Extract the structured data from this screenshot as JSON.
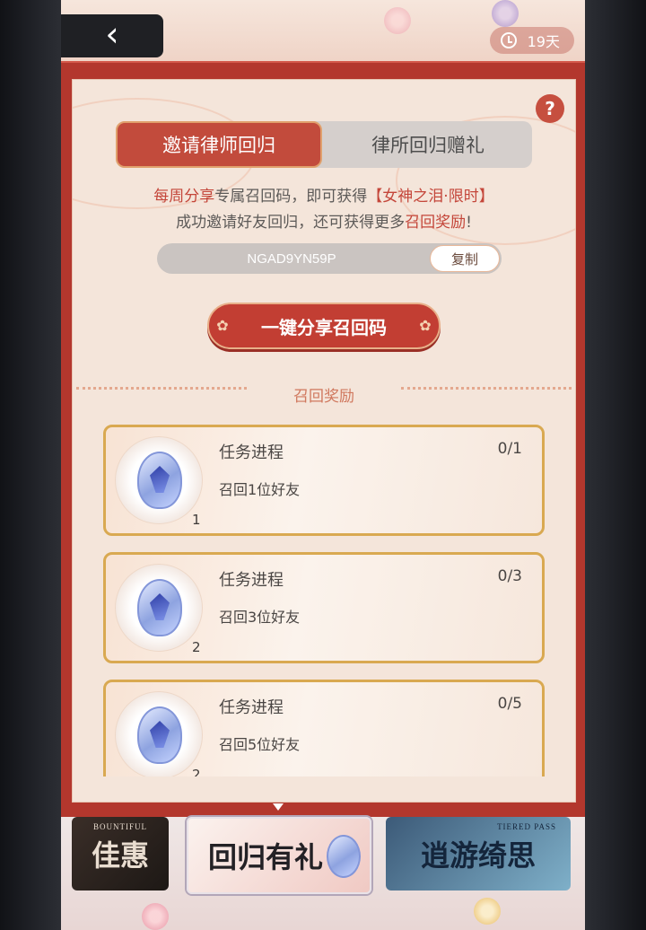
{
  "header": {
    "back_label": "‹",
    "days_label": "19天"
  },
  "tabs": [
    {
      "label": "邀请律师回归"
    },
    {
      "label": "律所回归赠礼"
    }
  ],
  "info": {
    "line1_a": "每周分享",
    "line1_b": "专属召回码，即可获得",
    "line1_c": "【女神之泪·限时】",
    "line2_a": "成功邀请好友回归，还可获得更多",
    "line2_b": "召回奖励",
    "line2_c": "!"
  },
  "code": {
    "value": "NGAD9YN59P",
    "copy_label": "复制"
  },
  "share_button": "一键分享召回码",
  "section_title": "召回奖励",
  "tasks": [
    {
      "title": "任务进程",
      "desc": "召回1位好友",
      "progress": "0/1",
      "qty": "1"
    },
    {
      "title": "任务进程",
      "desc": "召回3位好友",
      "progress": "0/3",
      "qty": "2"
    },
    {
      "title": "任务进程",
      "desc": "召回5位好友",
      "progress": "0/5",
      "qty": "2"
    }
  ],
  "banners": [
    {
      "big": "佳惠",
      "small": "BOUNTIFUL"
    },
    {
      "big": "回归有礼",
      "small": ""
    },
    {
      "big": "逍游绮思",
      "small": "TIERED PASS"
    }
  ],
  "colors": {
    "accent_red": "#c24b3c",
    "frame_red": "#b3372d",
    "gold": "#d9a951"
  }
}
